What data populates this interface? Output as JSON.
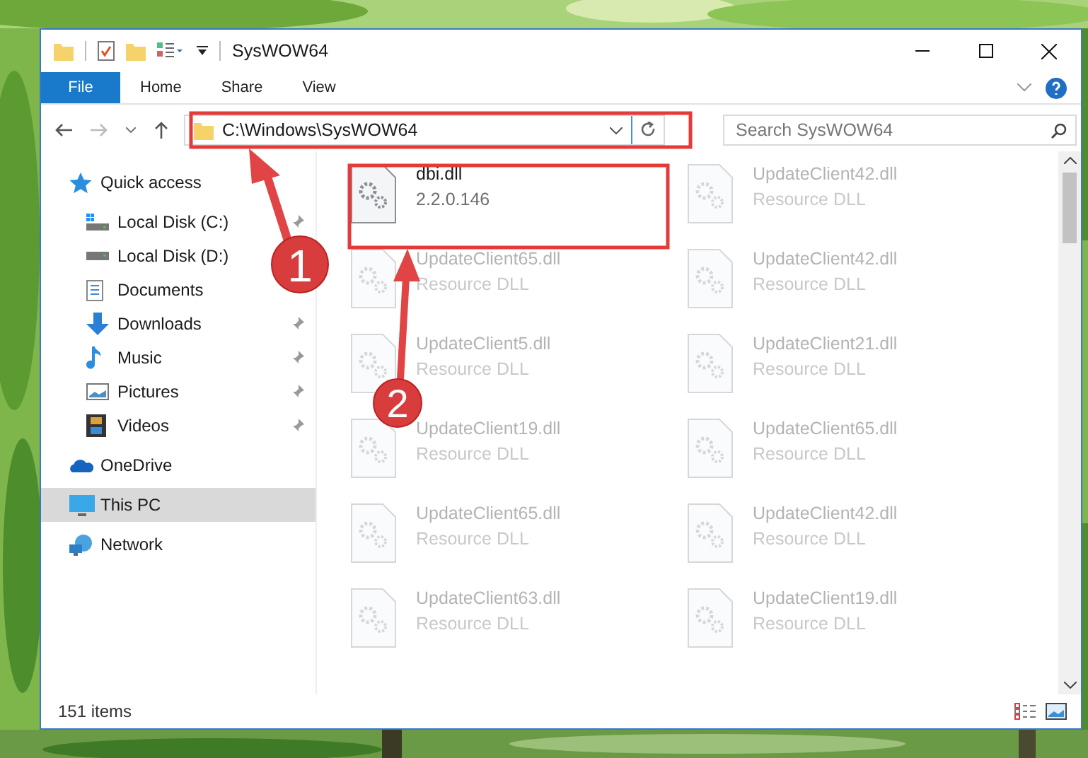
{
  "window": {
    "title": "SysWOW64"
  },
  "ribbon_tabs": [
    {
      "label": "File",
      "selected": true
    },
    {
      "label": "Home",
      "selected": false
    },
    {
      "label": "Share",
      "selected": false
    },
    {
      "label": "View",
      "selected": false
    }
  ],
  "address": {
    "path": "C:\\Windows\\SysWOW64"
  },
  "search": {
    "placeholder": "Search SysWOW64"
  },
  "nav": [
    {
      "label": "Quick access",
      "selected": false,
      "children": [
        {
          "label": "Local Disk (C:)",
          "pinned": true
        },
        {
          "label": "Local Disk (D:)",
          "pinned": false
        },
        {
          "label": "Documents",
          "pinned": false
        },
        {
          "label": "Downloads",
          "pinned": true
        },
        {
          "label": "Music",
          "pinned": true
        },
        {
          "label": "Pictures",
          "pinned": true
        },
        {
          "label": "Videos",
          "pinned": true
        }
      ]
    },
    {
      "label": "OneDrive",
      "selected": false
    },
    {
      "label": "This PC",
      "selected": true
    },
    {
      "label": "Network",
      "selected": false
    }
  ],
  "files": [
    {
      "name": "dbi.dll",
      "detail": "2.2.0.146",
      "blurred": false
    },
    {
      "name": "UpdateClient42.dll",
      "detail": "Resource DLL",
      "blurred": true
    },
    {
      "name": "UpdateClient65.dll",
      "detail": "Resource DLL",
      "blurred": true
    },
    {
      "name": "UpdateClient42.dll",
      "detail": "Resource DLL",
      "blurred": true
    },
    {
      "name": "UpdateClient5.dll",
      "detail": "Resource DLL",
      "blurred": true
    },
    {
      "name": "UpdateClient21.dll",
      "detail": "Resource DLL",
      "blurred": true
    },
    {
      "name": "UpdateClient19.dll",
      "detail": "Resource DLL",
      "blurred": true
    },
    {
      "name": "UpdateClient65.dll",
      "detail": "Resource DLL",
      "blurred": true
    },
    {
      "name": "UpdateClient65.dll",
      "detail": "Resource DLL",
      "blurred": true
    },
    {
      "name": "UpdateClient42.dll",
      "detail": "Resource DLL",
      "blurred": true
    },
    {
      "name": "UpdateClient63.dll",
      "detail": "Resource DLL",
      "blurred": true
    },
    {
      "name": "UpdateClient19.dll",
      "detail": "Resource DLL",
      "blurred": true
    }
  ],
  "status_bar": {
    "item_count": "151 items"
  },
  "callouts": [
    {
      "number": "1"
    },
    {
      "number": "2"
    }
  ]
}
